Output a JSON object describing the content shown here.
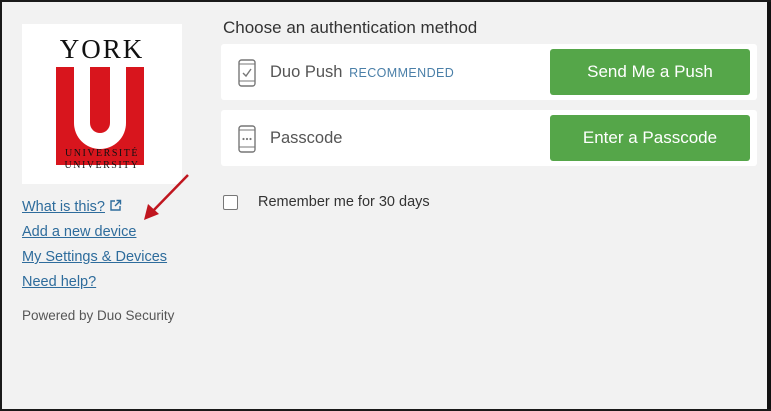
{
  "logo": {
    "top_text": "YORK",
    "line1": "UNIVERSITÉ",
    "line2": "UNIVERSITY"
  },
  "sidebar": {
    "links": [
      {
        "label": "What is this?",
        "icon": "external-link-icon"
      },
      {
        "label": "Add a new device"
      },
      {
        "label": "My Settings & Devices"
      },
      {
        "label": "Need help?"
      }
    ],
    "powered_by": "Powered by Duo Security"
  },
  "main": {
    "heading": "Choose an authentication method",
    "methods": [
      {
        "label": "Duo Push",
        "tag": "RECOMMENDED",
        "button": "Send Me a Push",
        "icon": "phone-check-icon"
      },
      {
        "label": "Passcode",
        "tag": "",
        "button": "Enter a Passcode",
        "icon": "phone-passcode-icon"
      }
    ],
    "remember_label": "Remember me for 30 days"
  },
  "colors": {
    "button_green": "#55a649",
    "link_blue": "#2e6c9c",
    "york_red": "#d8151d",
    "annotation_arrow": "#c0161f"
  }
}
